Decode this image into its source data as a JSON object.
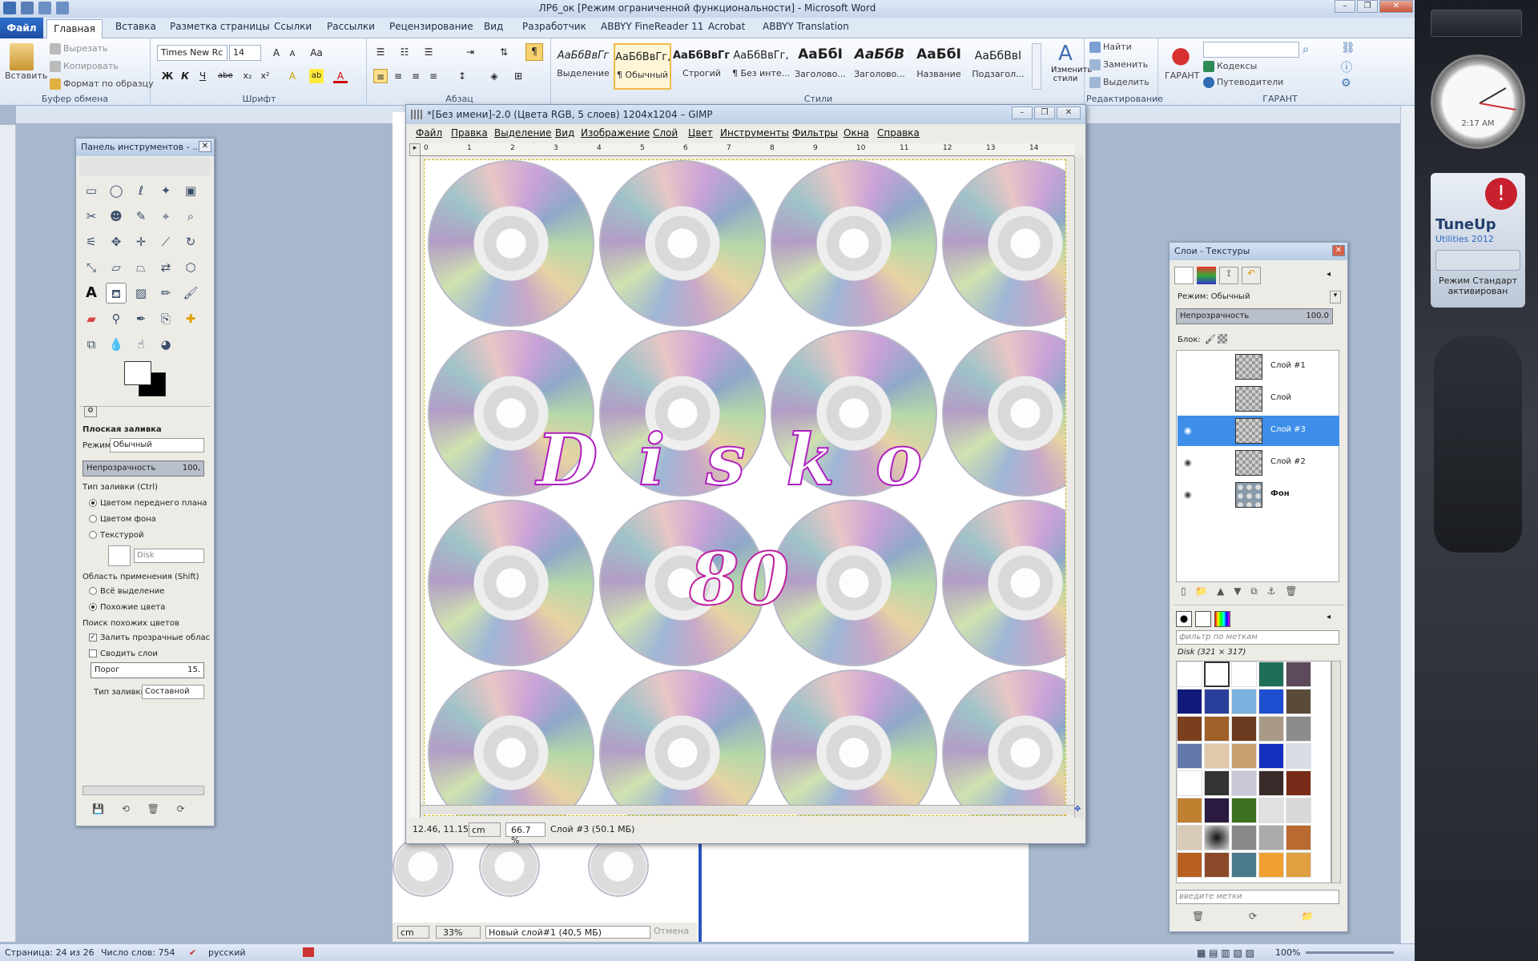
{
  "word": {
    "title": "ЛР6_ок [Режим ограниченной функциональности] - Microsoft Word",
    "tabs": [
      "Файл",
      "Главная",
      "Вставка",
      "Разметка страницы",
      "Ссылки",
      "Рассылки",
      "Рецензирование",
      "Вид",
      "Разработчик",
      "ABBYY FineReader 11",
      "Acrobat",
      "ABBYY Translation"
    ],
    "clipboard": {
      "paste": "Вставить",
      "cut": "Вырезать",
      "copy": "Копировать",
      "format_painter": "Формат по образцу",
      "label": "Буфер обмена"
    },
    "font": {
      "name": "Times New Rc",
      "size": "14",
      "label": "Шрифт",
      "bold": "Ж",
      "italic": "К",
      "underline": "Ч",
      "strike": "abe"
    },
    "paragraph": {
      "label": "Абзац"
    },
    "styles": {
      "label": "Стили",
      "items": [
        {
          "sample": "АаБбВвГг",
          "name": "Выделение"
        },
        {
          "sample": "АаБбВвГг,",
          "name": "¶ Обычный"
        },
        {
          "sample": "АаБбВвГг,",
          "name": "Строгий"
        },
        {
          "sample": "АаБбВвГг,",
          "name": "¶ Без инте..."
        },
        {
          "sample": "АаБбI",
          "name": "Заголово..."
        },
        {
          "sample": "АаБбВ",
          "name": "Заголово..."
        },
        {
          "sample": "АаБбI",
          "name": "Название"
        },
        {
          "sample": "АаБбВвI",
          "name": "Подзагол..."
        }
      ],
      "change": "Изменить стили"
    },
    "editing": {
      "find": "Найти",
      "replace": "Заменить",
      "select": "Выделить",
      "label": "Редактирование"
    },
    "garant": {
      "label": "ГАРАНТ",
      "big": "ГАРАНТ",
      "codes": "Кодексы",
      "guides": "Путеводители"
    },
    "status": {
      "page": "Страница: 24 из 26",
      "words": "Число слов: 754",
      "lang": "русский",
      "zoom": "100%"
    }
  },
  "gimp_toolbox": {
    "title": "Панель инструментов - ...",
    "tool_options_title": "Плоская заливка",
    "mode_label": "Режим:",
    "mode_value": "Обычный",
    "opacity_label": "Непрозрачность",
    "opacity_value": "100,",
    "fill_type_label": "Тип заливки (Ctrl)",
    "fill_fg": "Цветом переднего плана",
    "fill_bg": "Цветом фона",
    "fill_pattern": "Текстурой",
    "pattern_name": "Disk",
    "area_label": "Область применения (Shift)",
    "area_all": "Всё выделение",
    "area_similar": "Похожие цвета",
    "search_label": "Поиск похожих цветов",
    "fill_transparent": "Залить прозрачные облас",
    "merge_layers": "Сводить слои",
    "threshold_label": "Порог",
    "threshold_value": "15.",
    "fill_by_label": "Тип заливки:",
    "fill_by_value": "Составной"
  },
  "gimp_image": {
    "title": "*[Без имени]-2.0 (Цвета RGB, 5 слоев) 1204x1204 – GIMP",
    "menus": [
      "Файл",
      "Правка",
      "Выделение",
      "Вид",
      "Изображение",
      "Слой",
      "Цвет",
      "Инструменты",
      "Фильтры",
      "Окна",
      "Справка"
    ],
    "ruler_marks": [
      "0",
      "1",
      "2",
      "3",
      "4",
      "5",
      "6",
      "7",
      "8",
      "9",
      "10",
      "11",
      "12",
      "13",
      "14"
    ],
    "canvas_text_1": "D i s k o",
    "canvas_text_2": "80",
    "status_coords": "12.46, 11.15",
    "status_unit": "cm",
    "status_zoom": "66.7 %",
    "status_msg": "Слой #3 (50.1 МБ)"
  },
  "gimp_behind": {
    "unit": "cm",
    "zoom": "33%",
    "msg": "Новый слой#1 (40,5 МБ)",
    "cancel": "Отмена"
  },
  "gimp_layers": {
    "title": "Слои - Текстуры",
    "mode_label": "Режим:",
    "mode_value": "Обычный",
    "opacity_label": "Непрозрачность",
    "opacity_value": "100.0",
    "lock_label": "Блок:",
    "layers": [
      {
        "name": "Слой #1",
        "visible": false,
        "selected": false
      },
      {
        "name": "Слой",
        "visible": false,
        "selected": false
      },
      {
        "name": "Слой #3",
        "visible": true,
        "selected": true
      },
      {
        "name": "Слой #2",
        "visible": true,
        "selected": false
      },
      {
        "name": "Фон",
        "visible": true,
        "selected": false
      }
    ],
    "patterns_filter": "фильтр по меткам",
    "patterns_current": "Disk (321 × 317)",
    "tags_placeholder": "введите метки"
  },
  "desktop": {
    "clock_time": "2:17 AM",
    "tuneup_title": "TuneUp",
    "tuneup_sub": "Utilities 2012",
    "tuneup_mode": "Режим Стандарт активирован"
  }
}
